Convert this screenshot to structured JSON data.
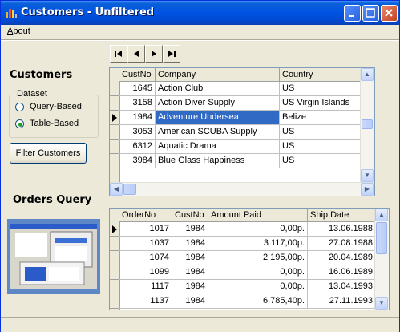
{
  "window": {
    "title": "Customers - Unfiltered"
  },
  "menu": {
    "about": "About"
  },
  "customers_section": {
    "heading": "Customers",
    "dataset_legend": "Dataset",
    "radio_query": "Query-Based",
    "radio_table": "Table-Based",
    "selected": "Table-Based",
    "filter_button": "Filter Customers"
  },
  "nav_buttons": [
    "first",
    "prior",
    "next",
    "last"
  ],
  "customers_grid": {
    "columns": [
      "CustNo",
      "Company",
      "Country"
    ],
    "rows": [
      [
        "1645",
        "Action Club",
        "US"
      ],
      [
        "3158",
        "Action Diver Supply",
        "US Virgin Islands"
      ],
      [
        "1984",
        "Adventure Undersea",
        "Belize"
      ],
      [
        "3053",
        "American SCUBA Supply",
        "US"
      ],
      [
        "6312",
        "Aquatic Drama",
        "US"
      ],
      [
        "3984",
        "Blue Glass Happiness",
        "US"
      ]
    ],
    "current_row": 2
  },
  "orders_section": {
    "heading": "Orders Query"
  },
  "orders_grid": {
    "columns": [
      "OrderNo",
      "CustNo",
      "Amount Paid",
      "Ship Date"
    ],
    "rows": [
      [
        "1017",
        "1984",
        "0,00р.",
        "13.06.1988"
      ],
      [
        "1037",
        "1984",
        "3 117,00р.",
        "27.08.1988"
      ],
      [
        "1074",
        "1984",
        "2 195,00р.",
        "20.04.1989"
      ],
      [
        "1099",
        "1984",
        "0,00р.",
        "16.06.1989"
      ],
      [
        "1117",
        "1984",
        "0,00р.",
        "13.04.1993"
      ],
      [
        "1137",
        "1984",
        "6 785,40р.",
        "27.11.1993"
      ]
    ],
    "current_row": 0
  }
}
